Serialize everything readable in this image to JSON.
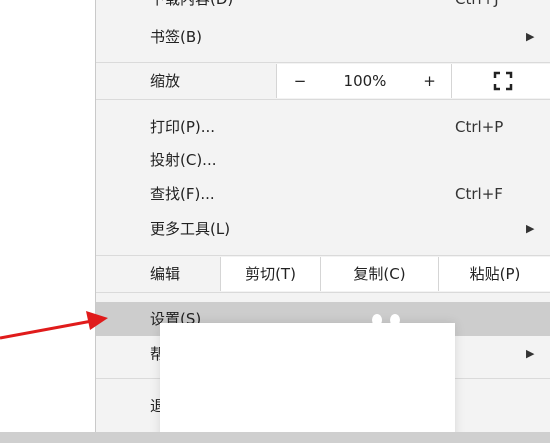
{
  "menu": {
    "partial_top_label": "下载内容(D)",
    "partial_top_shortcut": "Ctrl+J",
    "bookmarks": {
      "label": "书签(B)",
      "arrow": "▶"
    },
    "zoom": {
      "label": "缩放",
      "minus": "−",
      "value": "100%",
      "plus": "+"
    },
    "print": {
      "label": "打印(P)...",
      "shortcut": "Ctrl+P"
    },
    "cast": {
      "label": "投射(C)..."
    },
    "find": {
      "label": "查找(F)...",
      "shortcut": "Ctrl+F"
    },
    "more_tools": {
      "label": "更多工具(L)",
      "arrow": "▶"
    },
    "edit": {
      "label": "编辑",
      "cut": "剪切(T)",
      "copy": "复制(C)",
      "paste": "粘贴(P)"
    },
    "settings": {
      "label": "设置(S)"
    },
    "help": {
      "label": "帮助(E)",
      "arrow": "▶"
    },
    "exit": {
      "label": "退出(X)"
    }
  },
  "colors": {
    "menu_bg": "#f3f3f3",
    "highlight": "#cdcdcd",
    "arrow": "#e01b1b"
  }
}
